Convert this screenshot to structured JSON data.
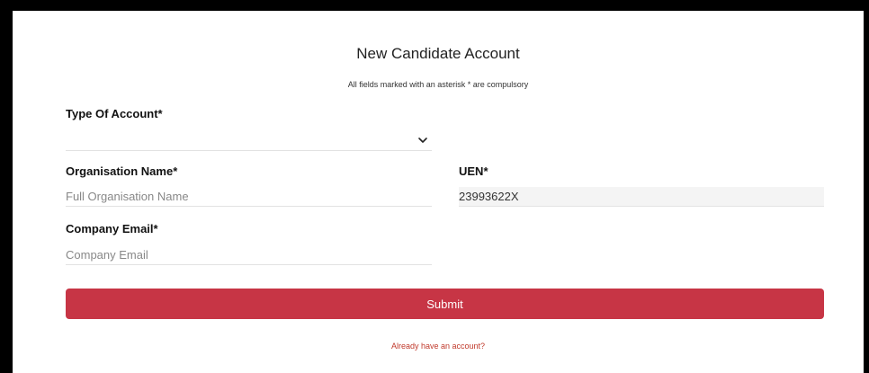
{
  "form": {
    "title": "New Candidate Account",
    "subtitle": "All fields marked with an asterisk * are compulsory",
    "type_of_account": {
      "label": "Type Of Account*",
      "selected_value": "",
      "icon": "chevron-down-icon"
    },
    "organisation_name": {
      "label": "Organisation Name*",
      "value": "",
      "placeholder": "Full Organisation Name"
    },
    "uen": {
      "label": "UEN*",
      "value": "23993622X"
    },
    "company_email": {
      "label": "Company Email*",
      "value": "",
      "placeholder": "Company Email"
    },
    "submit_label": "Submit",
    "login_link": "Already have an account?"
  },
  "colors": {
    "accent": "#c73545",
    "link": "#c0392b"
  }
}
